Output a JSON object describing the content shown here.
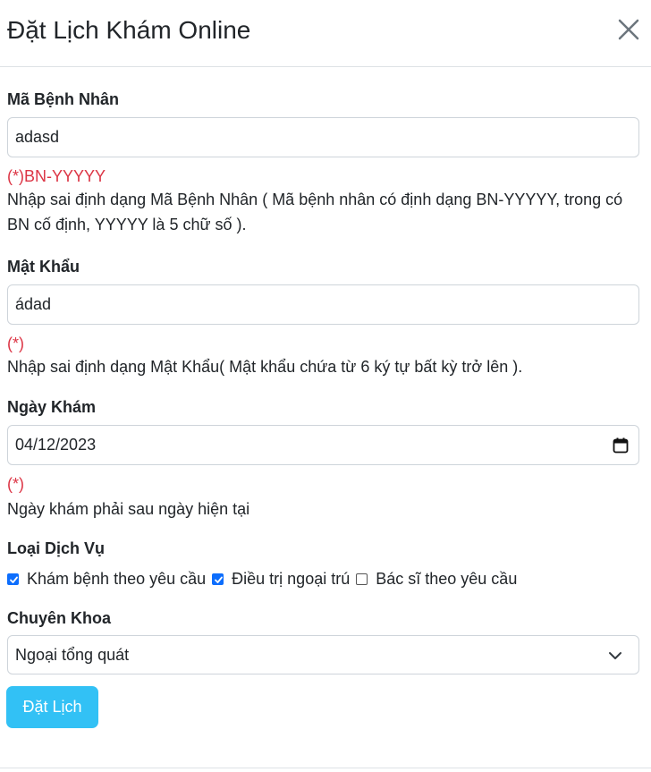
{
  "modal": {
    "title": "Đặt Lịch Khám Online"
  },
  "form": {
    "patient_id": {
      "label": "Mã Bệnh Nhân",
      "value": "adasd",
      "hint": "(*)BN-YYYYY",
      "error": "Nhập sai định dạng Mã Bệnh Nhân ( Mã bệnh nhân có định dạng BN-YYYYY, trong có BN cố định, YYYYY là 5 chữ số )."
    },
    "password": {
      "label": "Mật Khẩu",
      "value": "ádad",
      "hint": "(*)",
      "error": "Nhập sai định dạng Mật Khẩu( Mật khẩu chứa từ 6 ký tự bất kỳ trở lên )."
    },
    "exam_date": {
      "label": "Ngày Khám",
      "value": "04/12/2023",
      "hint": "(*)",
      "error": "Ngày khám phải sau ngày hiện tại"
    },
    "service_type": {
      "label": "Loại Dịch Vụ",
      "options": [
        {
          "label": "Khám bệnh theo yêu cầu",
          "checked": true
        },
        {
          "label": "Điều trị ngoại trú",
          "checked": true
        },
        {
          "label": "Bác sĩ theo yêu cầu",
          "checked": false
        }
      ]
    },
    "specialty": {
      "label": "Chuyên Khoa",
      "selected": "Ngoại tổng quát"
    },
    "submit_label": "Đặt Lịch"
  },
  "colors": {
    "error_red": "#dc3545",
    "checkbox_blue": "#0d6efd",
    "button_cyan": "#32c1f5",
    "border_gray": "#ced4da"
  }
}
